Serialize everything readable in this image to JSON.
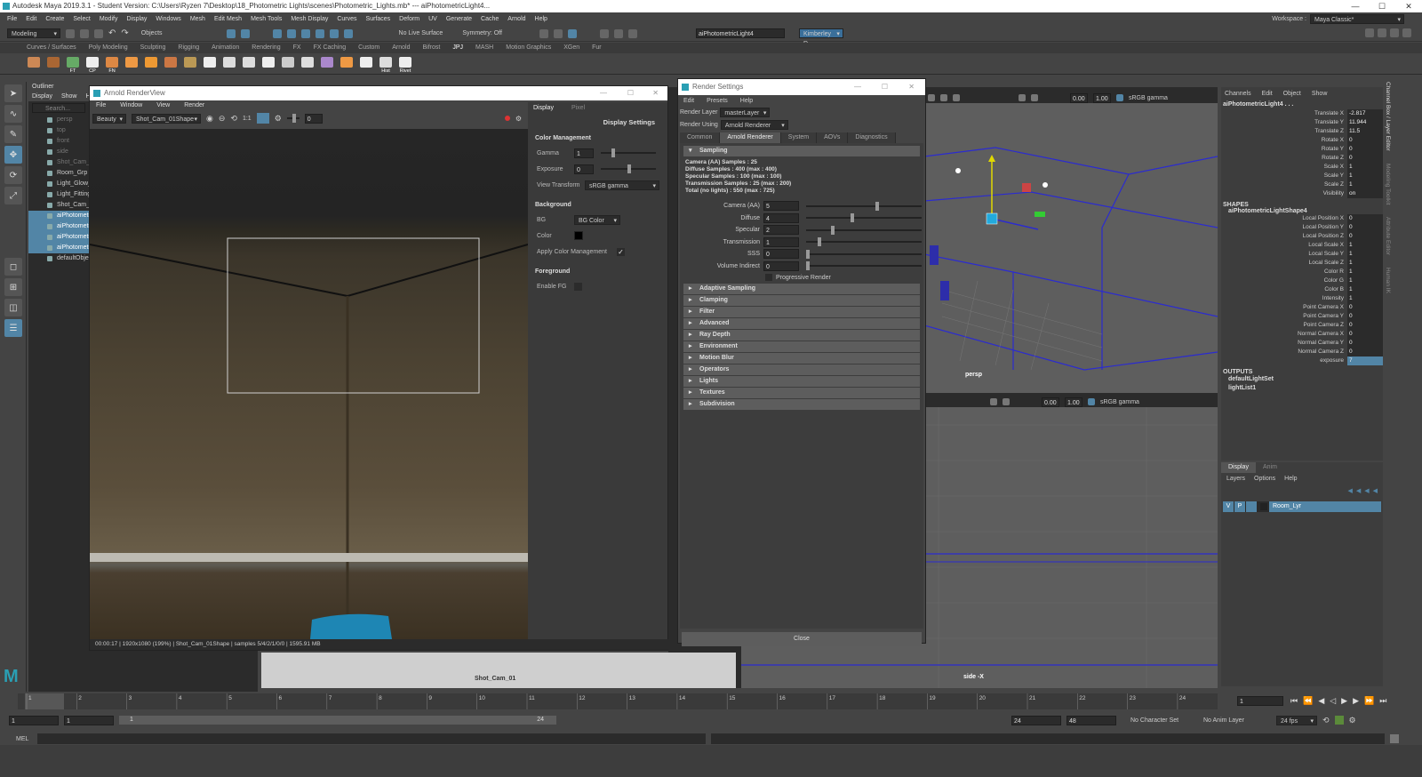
{
  "window": {
    "title": "Autodesk Maya 2019.3.1 - Student Version: C:\\Users\\Ryzen 7\\Desktop\\18_Photometric Lights\\scenes\\Photometric_Lights.mb* --- aiPhotometricLight4..."
  },
  "menus": [
    "File",
    "Edit",
    "Create",
    "Select",
    "Modify",
    "Display",
    "Windows",
    "Mesh",
    "Edit Mesh",
    "Mesh Tools",
    "Mesh Display",
    "Curves",
    "Surfaces",
    "Deform",
    "UV",
    "Generate",
    "Cache",
    "Arnold",
    "Help"
  ],
  "workspace": {
    "label": "Workspace :",
    "value": "Maya Classic*"
  },
  "status": {
    "mode": "Modeling",
    "objects": "Objects",
    "live_surface": "No Live Surface",
    "symmetry": "Symmetry: Off",
    "selected_name": "aiPhotometricLight4",
    "user": "Kimberley D..."
  },
  "shelf_tabs": [
    "Curves / Surfaces",
    "Poly Modeling",
    "Sculpting",
    "Rigging",
    "Animation",
    "Rendering",
    "FX",
    "FX Caching",
    "Custom",
    "Arnold",
    "Bifrost",
    "JPJ",
    "MASH",
    "Motion Graphics",
    "XGen",
    "Fur"
  ],
  "shelf_labels": [
    "FT",
    "CP",
    "FN",
    "Hist",
    "Rivet"
  ],
  "outliner": {
    "title": "Outliner",
    "menus": [
      "Display",
      "Show",
      "H"
    ],
    "search_placeholder": "Search...",
    "items": [
      {
        "label": "persp",
        "state": "dim"
      },
      {
        "label": "top",
        "state": "dim"
      },
      {
        "label": "front",
        "state": "dim"
      },
      {
        "label": "side",
        "state": "dim"
      },
      {
        "label": "Shot_Cam_",
        "state": "dim"
      },
      {
        "label": "Room_Grp",
        "state": "normal"
      },
      {
        "label": "Light_Glow_",
        "state": "normal"
      },
      {
        "label": "Light_Fitting",
        "state": "normal"
      },
      {
        "label": "Shot_Cam_0",
        "state": "normal"
      },
      {
        "label": "aiPhotometr",
        "state": "sel"
      },
      {
        "label": "aiPhotometr",
        "state": "sel"
      },
      {
        "label": "aiPhotometr",
        "state": "sel"
      },
      {
        "label": "aiPhotometr",
        "state": "sel"
      },
      {
        "label": "defaultObje",
        "state": "normal"
      }
    ]
  },
  "renderview": {
    "title": "Arnold RenderView",
    "menus": [
      "File",
      "Window",
      "View",
      "Render"
    ],
    "aov": "Beauty",
    "camera": "Shot_Cam_01Shape",
    "ratio": "1:1",
    "exposure_value": "0",
    "status": "00:00:17 | 1920x1080 (199%) | Shot_Cam_01Shape | samples 5/4/2/1/0/0 | 1595.91 MB",
    "tabs": [
      "Display",
      "Pixel"
    ],
    "display_settings": {
      "title": "Display Settings",
      "color_mgmt": "Color Management",
      "gamma_label": "Gamma",
      "gamma": "1",
      "exposure_label": "Exposure",
      "exposure": "0",
      "view_transform_label": "View Transform",
      "view_transform": "sRGB gamma",
      "background": "Background",
      "bg_label": "BG",
      "bg_value": "BG Color",
      "color_label": "Color",
      "apply_cm": "Apply Color Management",
      "foreground": "Foreground",
      "enable_fg": "Enable FG"
    }
  },
  "render_settings": {
    "title": "Render Settings",
    "menus": [
      "Edit",
      "Presets",
      "Help"
    ],
    "layer_label": "Render Layer",
    "layer": "masterLayer",
    "using_label": "Render Using",
    "using": "Arnold Renderer",
    "tabs": [
      "Common",
      "Arnold Renderer",
      "System",
      "AOVs",
      "Diagnostics"
    ],
    "sampling_title": "Sampling",
    "info": [
      "Camera (AA) Samples : 25",
      "Diffuse Samples : 400 (max : 400)",
      "Specular Samples : 100 (max : 100)",
      "Transmission Samples : 25 (max : 200)",
      "Total (no lights) : 550 (max : 725)"
    ],
    "samples": [
      {
        "label": "Camera (AA)",
        "value": "5",
        "level": 0.62
      },
      {
        "label": "Diffuse",
        "value": "4",
        "level": 0.4
      },
      {
        "label": "Specular",
        "value": "2",
        "level": 0.22
      },
      {
        "label": "Transmission",
        "value": "1",
        "level": 0.1
      },
      {
        "label": "SSS",
        "value": "0",
        "level": 0.0
      },
      {
        "label": "Volume Indirect",
        "value": "0",
        "level": 0.0
      }
    ],
    "progressive": "Progressive Render",
    "sections": [
      "Adaptive Sampling",
      "Clamping",
      "Filter",
      "Advanced",
      "Ray Depth",
      "Environment",
      "Motion Blur",
      "Operators",
      "Lights",
      "Textures",
      "Subdivision"
    ],
    "close": "Close"
  },
  "viewports": {
    "gamma_a": "0.00",
    "gamma_b": "1.00",
    "color_space": "sRGB gamma",
    "persp_label": "persp",
    "shot_label": "Shot_Cam_01",
    "side_label": "side -X"
  },
  "channel_box": {
    "menus": [
      "Channels",
      "Edit",
      "Object",
      "Show"
    ],
    "object": "aiPhotometricLight4 . . .",
    "transform": [
      {
        "label": "Translate X",
        "value": "-2.817"
      },
      {
        "label": "Translate Y",
        "value": "11.944"
      },
      {
        "label": "Translate Z",
        "value": "11.5"
      },
      {
        "label": "Rotate X",
        "value": "0"
      },
      {
        "label": "Rotate Y",
        "value": "0"
      },
      {
        "label": "Rotate Z",
        "value": "0"
      },
      {
        "label": "Scale X",
        "value": "1"
      },
      {
        "label": "Scale Y",
        "value": "1"
      },
      {
        "label": "Scale Z",
        "value": "1"
      },
      {
        "label": "Visibility",
        "value": "on"
      }
    ],
    "shapes_title": "SHAPES",
    "shape_name": "aiPhotometricLightShape4",
    "shape_attrs": [
      {
        "label": "Local Position X",
        "value": "0"
      },
      {
        "label": "Local Position Y",
        "value": "0"
      },
      {
        "label": "Local Position Z",
        "value": "0"
      },
      {
        "label": "Local Scale X",
        "value": "1"
      },
      {
        "label": "Local Scale Y",
        "value": "1"
      },
      {
        "label": "Local Scale Z",
        "value": "1"
      },
      {
        "label": "Color R",
        "value": "1"
      },
      {
        "label": "Color G",
        "value": "1"
      },
      {
        "label": "Color B",
        "value": "1"
      },
      {
        "label": "Intensity",
        "value": "1"
      },
      {
        "label": "Point Camera X",
        "value": "0"
      },
      {
        "label": "Point Camera Y",
        "value": "0"
      },
      {
        "label": "Point Camera Z",
        "value": "0"
      },
      {
        "label": "Normal Camera X",
        "value": "0"
      },
      {
        "label": "Normal Camera Y",
        "value": "0"
      },
      {
        "label": "Normal Camera Z",
        "value": "0"
      },
      {
        "label": "exposure",
        "value": "7"
      }
    ],
    "outputs_title": "OUTPUTS",
    "outputs": [
      "defaultLightSet",
      "lightList1"
    ],
    "side_tabs": [
      "Channel Box / Layer Editor",
      "Modeling Toolkit",
      "Attribute Editor",
      "Human IK"
    ]
  },
  "layer_editor": {
    "tabs": [
      "Display",
      "Anim"
    ],
    "menus": [
      "Layers",
      "Options",
      "Help"
    ],
    "layer": "Room_Lyr",
    "v": "V",
    "p": "P"
  },
  "timeline": {
    "ticks": [
      "1",
      "2",
      "3",
      "4",
      "5",
      "6",
      "7",
      "8",
      "9",
      "10",
      "11",
      "12",
      "13",
      "14",
      "15",
      "16",
      "17",
      "18",
      "19",
      "20",
      "21",
      "22",
      "23",
      "24"
    ],
    "current_frame": "1"
  },
  "range": {
    "start": "1",
    "start_inner": "1",
    "range_start": "1",
    "range_end": "24",
    "end_inner": "24",
    "end": "48",
    "character_set": "No Character Set",
    "anim_layer": "No Anim Layer",
    "fps": "24 fps"
  },
  "cmd": {
    "label": "MEL"
  },
  "colors": {
    "accent": "#5285a6",
    "panel": "#444444",
    "dark": "#2b2b2b"
  }
}
